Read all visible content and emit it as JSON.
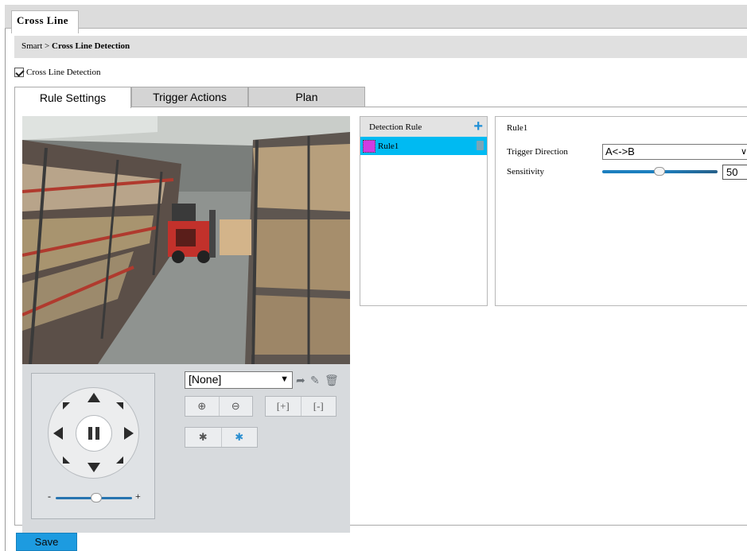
{
  "window": {
    "tab_label": "Cross Line"
  },
  "breadcrumb": {
    "parent": "Smart",
    "separator": ">",
    "current": "Cross Line Detection"
  },
  "enable": {
    "label": "Cross Line Detection",
    "checked": true
  },
  "tabs": [
    {
      "label": "Rule Settings",
      "active": true
    },
    {
      "label": "Trigger Actions",
      "active": false
    },
    {
      "label": "Plan",
      "active": false
    }
  ],
  "ptz": {
    "preset_value": "[None]",
    "zoom_minus": "-",
    "zoom_plus": "+",
    "icons": [
      "go-to-preset-icon",
      "edit-preset-icon",
      "delete-preset-icon",
      "zoom-in-icon",
      "zoom-out-icon",
      "focus-near-icon",
      "focus-far-icon",
      "wiper-icon",
      "light-icon"
    ]
  },
  "detection": {
    "header": "Detection Rule",
    "rules": [
      {
        "name": "Rule1",
        "color": "#d03ce2",
        "selected": true
      }
    ]
  },
  "config": {
    "title": "Rule1",
    "direction_label": "Trigger Direction",
    "direction_value": "A<->B",
    "sensitivity_label": "Sensitivity",
    "sensitivity_value": "50"
  },
  "actions": {
    "save_label": "Save"
  },
  "colors": {
    "accent": "#1d9be0",
    "selected_row": "#00baf2"
  }
}
